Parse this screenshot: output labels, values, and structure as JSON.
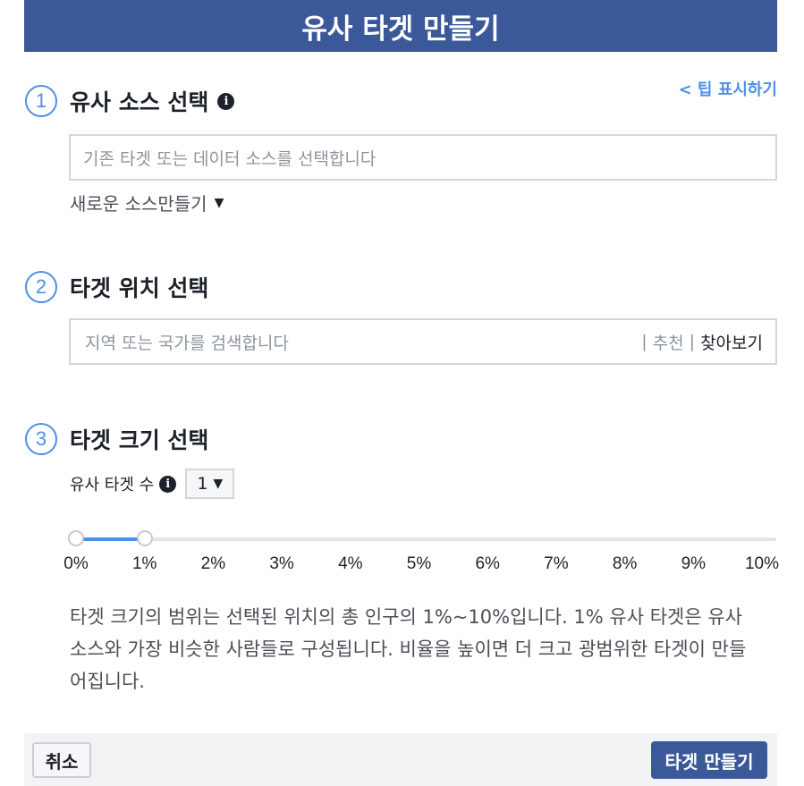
{
  "header": {
    "title": "유사 타겟 만들기"
  },
  "tip_link": "< 팁 표시하기",
  "steps": [
    {
      "number": "1",
      "title": "유사 소스 선택"
    },
    {
      "number": "2",
      "title": "타겟 위치 선택"
    },
    {
      "number": "3",
      "title": "타겟 크기 선택"
    }
  ],
  "source": {
    "placeholder": "기존 타겟 또는 데이터 소스를 선택합니다",
    "create_new": "새로운 소스만들기"
  },
  "location": {
    "placeholder": "지역 또는 국가를 검색합니다",
    "recommend": "추천",
    "browse": "찾아보기",
    "separator": "|"
  },
  "size": {
    "count_label": "유사 타겟 수",
    "count_value": "1",
    "slider_value_percent": 1,
    "ticks": [
      "0%",
      "1%",
      "2%",
      "3%",
      "4%",
      "5%",
      "6%",
      "7%",
      "8%",
      "9%",
      "10%"
    ],
    "description": "타겟 크기의 범위는 선택된 위치의 총 인구의 1%~10%입니다. 1% 유사 타겟은 유사 소스와 가장 비슷한 사람들로 구성됩니다. 비율을 높이면 더 크고 광범위한 타겟이 만들어집니다."
  },
  "footer": {
    "cancel": "취소",
    "create": "타겟 만들기"
  },
  "colors": {
    "header_bg": "#3b5998",
    "accent": "#4c8fe8",
    "primary_button": "#3b5998"
  },
  "icons": {
    "info": "info-circle-icon",
    "caret": "caret-down-icon"
  }
}
